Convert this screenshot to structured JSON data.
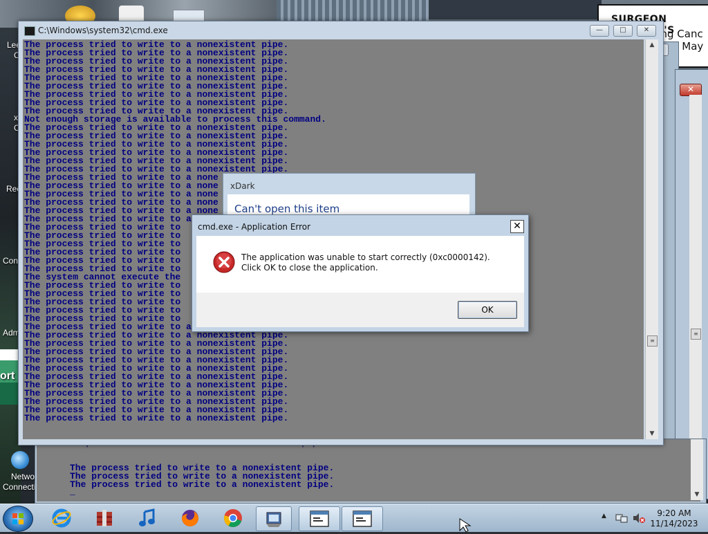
{
  "desktop": {
    "sign_title": "SURGEON GENERAL'S",
    "sign_lines": [
      "ung Canc",
      "d May"
    ],
    "icons": [
      {
        "label": "Lee",
        "name": "desktop-icon-lee"
      },
      {
        "label": "C",
        "name": "desktop-icon-c"
      },
      {
        "label": "x",
        "name": "desktop-icon-x"
      },
      {
        "label": "C",
        "name": "desktop-icon-c2"
      },
      {
        "label": "Rec",
        "name": "desktop-icon-rec"
      },
      {
        "label": "Con",
        "name": "desktop-icon-con"
      },
      {
        "label": "Adm",
        "name": "desktop-icon-adm"
      },
      {
        "label": "ort",
        "name": "desktop-icon-ort"
      }
    ],
    "network_label_1": "Network",
    "network_label_2": "Connections"
  },
  "cmd_window": {
    "title": "C:\\Windows\\system32\\cmd.exe",
    "minimize": "—",
    "maximize": "□",
    "close": "✕"
  },
  "back_console": {
    "partial_line": "The process tried to write to a nonexistent pipe.",
    "lines": [
      "The process tried to write to a nonexistent pipe.",
      "The process tried to write to a nonexistent pipe.",
      "The process tried to write to a nonexistent pipe."
    ],
    "cursor": "_"
  },
  "console_lines": [
    "The process tried to write to a nonexistent pipe.",
    "The process tried to write to a nonexistent pipe.",
    "The process tried to write to a nonexistent pipe.",
    "The process tried to write to a nonexistent pipe.",
    "The process tried to write to a nonexistent pipe.",
    "The process tried to write to a nonexistent pipe.",
    "The process tried to write to a nonexistent pipe.",
    "The process tried to write to a nonexistent pipe.",
    "The process tried to write to a nonexistent pipe.",
    "Not enough storage is available to process this command.",
    "The process tried to write to a nonexistent pipe.",
    "The process tried to write to a nonexistent pipe.",
    "The process tried to write to a nonexistent pipe.",
    "The process tried to write to a nonexistent pipe.",
    "The process tried to write to a nonexistent pipe.",
    "The process tried to write to a nonexistent pipe.",
    "The process tried to write to a none",
    "The process tried to write to a none",
    "The process tried to write to a none",
    "The process tried to write to a none",
    "The process tried to write to a none",
    "The process tried to write to a none",
    "The process tried to write to",
    "The process tried to write to",
    "The process tried to write to",
    "The process tried to write to",
    "The process tried to write to",
    "The process tried to write to",
    "The system cannot execute the",
    "The process tried to write to",
    "The process tried to write to",
    "The process tried to write to",
    "The process tried to write to",
    "The process tried to write to",
    "The process tried to write to a nonexistent pipe.",
    "The process tried to write to a nonexistent pipe.",
    "The process tried to write to a nonexistent pipe.",
    "The process tried to write to a nonexistent pipe.",
    "The process tried to write to a nonexistent pipe.",
    "The process tried to write to a nonexistent pipe.",
    "The process tried to write to a nonexistent pipe.",
    "The process tried to write to a nonexistent pipe.",
    "The process tried to write to a nonexistent pipe.",
    "The process tried to write to a nonexistent pipe.",
    "The process tried to write to a nonexistent pipe.",
    "The process tried to write to a nonexistent pipe."
  ],
  "xdark_dialog": {
    "caption": "xDark",
    "heading": "Can't open this item"
  },
  "error_dialog": {
    "caption": "cmd.exe - Application Error",
    "close": "✕",
    "message": "The application was unable to start correctly (0xc0000142). Click OK to close the application.",
    "ok_label": "OK"
  },
  "taskbar": {
    "items": [
      {
        "name": "taskbar-ie-button",
        "icon": "internet-explorer-icon"
      },
      {
        "name": "taskbar-archive-button",
        "icon": "archive-icon"
      },
      {
        "name": "taskbar-music-button",
        "icon": "music-note-icon"
      },
      {
        "name": "taskbar-firefox-button",
        "icon": "firefox-icon"
      },
      {
        "name": "taskbar-chrome-button",
        "icon": "chrome-icon"
      },
      {
        "name": "taskbar-app-button",
        "icon": "app-icon"
      },
      {
        "name": "taskbar-cmd-button-1",
        "icon": "window-icon"
      },
      {
        "name": "taskbar-cmd-button-2",
        "icon": "window-icon"
      }
    ],
    "time": "9:20 AM",
    "date": "11/14/2023"
  },
  "colors": {
    "console_bg": "#808080",
    "console_text": "#000080",
    "error_icon": "#d32f2f",
    "dialog_heading": "#1e3f8a"
  }
}
